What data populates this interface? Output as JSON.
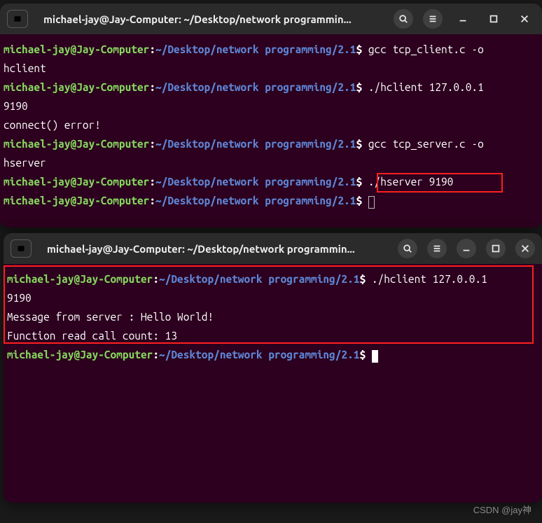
{
  "window1": {
    "title": "michael-jay@Jay-Computer: ~/Desktop/network programmin...",
    "prompt": {
      "user": "michael-jay@Jay-Computer",
      "path": "~/Desktop/network programming/2.1",
      "symbol": "$"
    },
    "lines": [
      {
        "type": "cmd",
        "text": "gcc tcp_client.c -o hclient",
        "wrap": true
      },
      {
        "type": "cmd",
        "text": "./hclient 127.0.0.1 9190",
        "wrap": true
      },
      {
        "type": "out",
        "text": "connect() error!"
      },
      {
        "type": "cmd",
        "text": "gcc tcp_server.c -o hserver",
        "wrap": true
      },
      {
        "type": "cmd",
        "text": "./hserver 9190",
        "highlight": true
      },
      {
        "type": "cmd",
        "text": "",
        "cursor": "box"
      }
    ]
  },
  "window2": {
    "title": "michael-jay@Jay-Computer: ~/Desktop/network programmin...",
    "prompt": {
      "user": "michael-jay@Jay-Computer",
      "path": "~/Desktop/network programming/2.1",
      "symbol": "$"
    },
    "lines": [
      {
        "type": "cmd",
        "text": "./hclient 127.0.0.1 9190",
        "wrap": true
      },
      {
        "type": "out",
        "text": "Message from server : Hello World!"
      },
      {
        "type": "out",
        "text": "Function read call count: 13"
      },
      {
        "type": "cmd",
        "text": "",
        "cursor": "solid"
      }
    ]
  },
  "watermark": "CSDN @jay神"
}
